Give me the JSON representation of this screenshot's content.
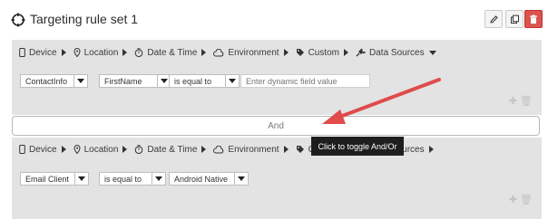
{
  "header": {
    "title": "Targeting rule set 1",
    "icons": [
      "crosshair-icon",
      "edit-icon",
      "copy-icon",
      "delete-icon"
    ]
  },
  "tabs": [
    {
      "label": "Device",
      "icon": "mobile-icon"
    },
    {
      "label": "Location",
      "icon": "location-pin-icon"
    },
    {
      "label": "Date & Time",
      "icon": "stopwatch-icon"
    },
    {
      "label": "Environment",
      "icon": "cloud-icon"
    },
    {
      "label": "Custom",
      "icon": "tag-icon"
    },
    {
      "label": "Data Sources",
      "icon": "plug-icon"
    }
  ],
  "rule1": {
    "field": "ContactInfo",
    "subfield": "FirstName",
    "operator": "is equal to",
    "value_placeholder": "Enter dynamic field value"
  },
  "combinator": {
    "label": "And"
  },
  "tooltip": {
    "text": "Click to toggle And/Or"
  },
  "rule2": {
    "field": "Email Client",
    "operator": "is equal to",
    "value": "Android Native"
  },
  "colors": {
    "annotation_arrow": "#e04b4b",
    "delete_button": "#d9534f",
    "panel_bg": "#e3e3e3"
  }
}
